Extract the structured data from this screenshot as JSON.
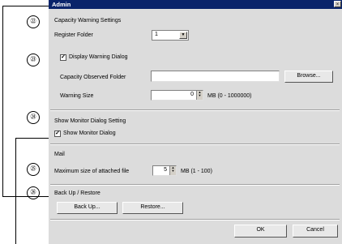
{
  "window": {
    "title": "Admin",
    "close_glyph": "×"
  },
  "callouts": [
    "㉒",
    "㉓",
    "㉔",
    "㉕",
    "㉖"
  ],
  "capacity": {
    "heading": "Capacity Warning Settings",
    "register_folder_label": "Register Folder",
    "register_folder_value": "1",
    "display_warning_dialog_label": "Display Warning Dialog",
    "display_warning_dialog_checked": true,
    "observed_folder_label": "Capacity Observed Folder",
    "observed_folder_value": "",
    "browse_label": "Browse...",
    "warning_size_label": "Warning Size",
    "warning_size_value": "0",
    "warning_size_unit": "MB (0 - 1000000)"
  },
  "monitor": {
    "heading": "Show Monitor Dialog Setting",
    "show_monitor_label": "Show Monitor Dialog",
    "show_monitor_checked": true
  },
  "mail": {
    "heading": "Mail",
    "max_size_label": "Maximum size of attached file",
    "max_size_value": "5",
    "max_size_unit": "MB (1 - 100)"
  },
  "backup": {
    "heading": "Back Up / Restore",
    "backup_label": "Back Up...",
    "restore_label": "Restore..."
  },
  "footer": {
    "ok_label": "OK",
    "cancel_label": "Cancel"
  },
  "colors": {
    "titlebar": "#0a246a",
    "window_bg": "#dcdcdc"
  }
}
